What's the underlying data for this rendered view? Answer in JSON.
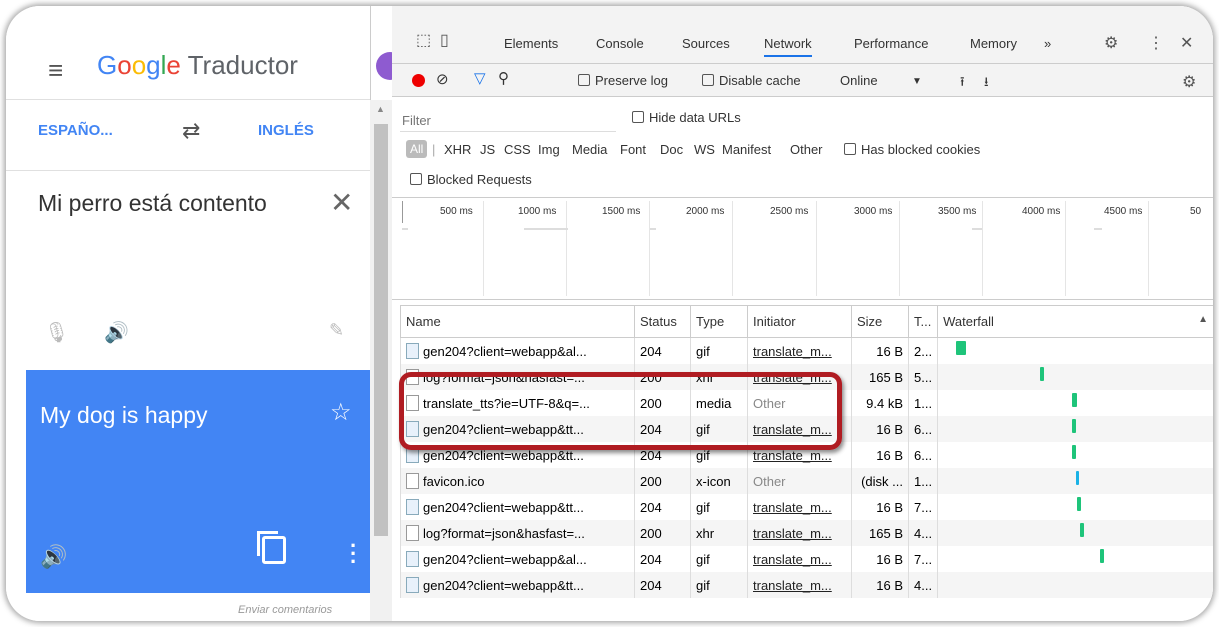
{
  "translate": {
    "logo": {
      "g1": "G",
      "g2": "o",
      "g3": "o",
      "g4": "g",
      "g5": "l",
      "g6": "e",
      "rest": " Traductor"
    },
    "source_lang": "ESPAÑO...",
    "target_lang": "INGLÉS",
    "source_text": "Mi perro está contento",
    "result_text": "My dog is happy",
    "feedback_link": "Enviar comentarios",
    "colors": {
      "brand_blue": "#4285f4",
      "logo_red": "#ea4335",
      "logo_yellow": "#fbbc05",
      "logo_green": "#34a853"
    },
    "icons": [
      "menu-icon",
      "swap-icon",
      "close-icon",
      "mic-icon",
      "speaker-icon",
      "pencil-icon",
      "star-icon",
      "copy-icon",
      "more-vert-icon"
    ]
  },
  "devtools": {
    "tabs": [
      "Elements",
      "Console",
      "Sources",
      "Network",
      "Performance",
      "Memory",
      "»"
    ],
    "active_tab": "Network",
    "toolbar": {
      "preserve_log": "Preserve log",
      "disable_cache": "Disable cache",
      "throttling": "Online"
    },
    "filter": {
      "placeholder": "Filter",
      "hide_data_urls": "Hide data URLs",
      "all": "All",
      "types": [
        "XHR",
        "JS",
        "CSS",
        "Img",
        "Media",
        "Font",
        "Doc",
        "WS",
        "Manifest",
        "Other"
      ],
      "has_blocked_cookies": "Has blocked cookies",
      "blocked_requests": "Blocked Requests"
    },
    "timeline_ticks": [
      "500 ms",
      "1000 ms",
      "1500 ms",
      "2000 ms",
      "2500 ms",
      "3000 ms",
      "3500 ms",
      "4000 ms",
      "4500 ms",
      "50"
    ],
    "columns": [
      "Name",
      "Status",
      "Type",
      "Initiator",
      "Size",
      "T...",
      "Waterfall"
    ],
    "rows": [
      {
        "name": "gen204?client=webapp&al...",
        "status": "204",
        "type": "gif",
        "initiator": "translate_m...",
        "size": "16 B",
        "time": "2...",
        "icon": "image"
      },
      {
        "name": "log?format=json&hasfast=...",
        "status": "200",
        "type": "xhr",
        "initiator": "translate_m...",
        "size": "165 B",
        "time": "5...",
        "icon": "doc"
      },
      {
        "name": "translate_tts?ie=UTF-8&q=...",
        "status": "200",
        "type": "media",
        "initiator": "Other",
        "size": "9.4 kB",
        "time": "1...",
        "icon": "doc"
      },
      {
        "name": "gen204?client=webapp&tt...",
        "status": "204",
        "type": "gif",
        "initiator": "translate_m...",
        "size": "16 B",
        "time": "6...",
        "icon": "image"
      },
      {
        "name": "gen204?client=webapp&tt...",
        "status": "204",
        "type": "gif",
        "initiator": "translate_m...",
        "size": "16 B",
        "time": "6...",
        "icon": "image"
      },
      {
        "name": "favicon.ico",
        "status": "200",
        "type": "x-icon",
        "initiator": "Other",
        "size": "(disk ...",
        "time": "1...",
        "icon": "doc"
      },
      {
        "name": "gen204?client=webapp&tt...",
        "status": "204",
        "type": "gif",
        "initiator": "translate_m...",
        "size": "16 B",
        "time": "7...",
        "icon": "image"
      },
      {
        "name": "log?format=json&hasfast=...",
        "status": "200",
        "type": "xhr",
        "initiator": "translate_m...",
        "size": "165 B",
        "time": "4...",
        "icon": "doc"
      },
      {
        "name": "gen204?client=webapp&al...",
        "status": "204",
        "type": "gif",
        "initiator": "translate_m...",
        "size": "16 B",
        "time": "7...",
        "icon": "image"
      },
      {
        "name": "gen204?client=webapp&tt...",
        "status": "204",
        "type": "gif",
        "initiator": "translate_m...",
        "size": "16 B",
        "time": "4...",
        "icon": "image"
      }
    ],
    "highlight_color": "#b01c22"
  }
}
